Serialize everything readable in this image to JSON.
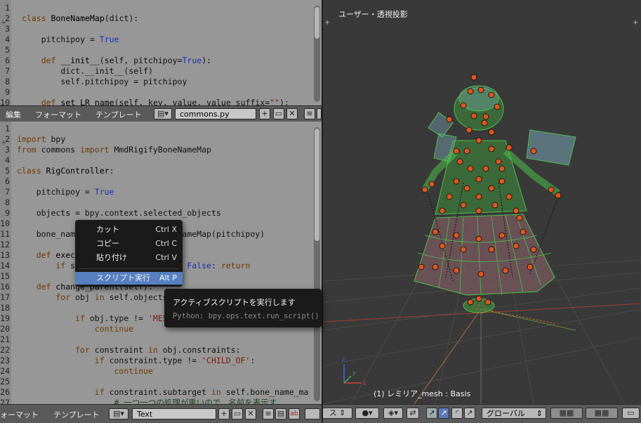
{
  "top_editor": {
    "lines": [
      {
        "n": "1",
        "parts": []
      },
      {
        "n": "2",
        "parts": [
          [
            "kw",
            "class "
          ],
          [
            "fn",
            "BoneNameMap"
          ],
          [
            "plain",
            "(dict):"
          ]
        ]
      },
      {
        "n": "3",
        "parts": []
      },
      {
        "n": "4",
        "parts": [
          [
            "plain",
            "    pitchipoy = "
          ],
          [
            "blue",
            "True"
          ]
        ]
      },
      {
        "n": "5",
        "parts": []
      },
      {
        "n": "6",
        "parts": [
          [
            "plain",
            "    "
          ],
          [
            "kw",
            "def "
          ],
          [
            "fn",
            "__init__"
          ],
          [
            "plain",
            "(self, pitchipoy="
          ],
          [
            "blue",
            "True"
          ],
          [
            "plain",
            "):"
          ]
        ]
      },
      {
        "n": "7",
        "parts": [
          [
            "plain",
            "        dict.__init__(self)"
          ]
        ]
      },
      {
        "n": "8",
        "parts": [
          [
            "plain",
            "        self.pitchipoy = pitchipoy"
          ]
        ]
      },
      {
        "n": "9",
        "parts": []
      },
      {
        "n": "10",
        "parts": [
          [
            "plain",
            "    "
          ],
          [
            "kw",
            "def "
          ],
          [
            "fn",
            "set_LR_name"
          ],
          [
            "plain",
            "(self, key, value, value_suffix="
          ],
          [
            "str",
            "\"\""
          ],
          [
            "plain",
            "):"
          ]
        ]
      }
    ]
  },
  "top_header": {
    "menu_edit": "編集",
    "menu_format": "フォーマット",
    "menu_templates": "テンプレート",
    "file_name": "commons.py"
  },
  "bottom_editor": {
    "lines": [
      {
        "n": "1",
        "parts": []
      },
      {
        "n": "2",
        "parts": [
          [
            "kw",
            "import "
          ],
          [
            "plain",
            "bpy"
          ]
        ]
      },
      {
        "n": "3",
        "parts": [
          [
            "kw",
            "from "
          ],
          [
            "plain",
            "commons "
          ],
          [
            "kw",
            "import "
          ],
          [
            "plain",
            "MmdRigifyBoneNameMap"
          ]
        ]
      },
      {
        "n": "4",
        "parts": []
      },
      {
        "n": "5",
        "parts": [
          [
            "kw",
            "class "
          ],
          [
            "fn",
            "RigController"
          ],
          [
            "plain",
            ":"
          ]
        ]
      },
      {
        "n": "6",
        "parts": []
      },
      {
        "n": "7",
        "parts": [
          [
            "plain",
            "    pitchipoy = "
          ],
          [
            "blue",
            "True"
          ]
        ]
      },
      {
        "n": "8",
        "parts": []
      },
      {
        "n": "9",
        "parts": [
          [
            "plain",
            "    objects = bpy.context.selected_objects"
          ]
        ]
      },
      {
        "n": "10",
        "parts": []
      },
      {
        "n": "11",
        "parts": [
          [
            "plain",
            "    bone_name_m"
          ],
          [
            "plain",
            "ap = MmdRigifyBoneNameMap(pitchipoy)"
          ]
        ]
      },
      {
        "n": "12",
        "parts": []
      },
      {
        "n": "13",
        "parts": [
          [
            "plain",
            "    "
          ],
          [
            "kw",
            "def "
          ],
          [
            "fn",
            "execute"
          ]
        ]
      },
      {
        "n": "14",
        "parts": [
          [
            "plain",
            "        "
          ],
          [
            "kw",
            "if "
          ],
          [
            "plain",
            "self.change_parent() == "
          ],
          [
            "blue",
            "False"
          ],
          [
            "plain",
            ": "
          ],
          [
            "kw",
            "return"
          ]
        ]
      },
      {
        "n": "15",
        "parts": []
      },
      {
        "n": "16",
        "parts": [
          [
            "plain",
            "    "
          ],
          [
            "kw",
            "def "
          ],
          [
            "fn",
            "change_parent"
          ],
          [
            "plain",
            "(self):"
          ]
        ]
      },
      {
        "n": "17",
        "parts": [
          [
            "plain",
            "        "
          ],
          [
            "kw",
            "for "
          ],
          [
            "plain",
            "obj "
          ],
          [
            "kw",
            "in "
          ],
          [
            "plain",
            "self.objects:"
          ]
        ]
      },
      {
        "n": "18",
        "parts": []
      },
      {
        "n": "19",
        "parts": [
          [
            "plain",
            "            "
          ],
          [
            "kw",
            "if "
          ],
          [
            "plain",
            "obj.type != "
          ],
          [
            "str",
            "'MESH'"
          ],
          [
            "plain",
            ":"
          ]
        ]
      },
      {
        "n": "20",
        "parts": [
          [
            "plain",
            "                "
          ],
          [
            "kw",
            "continue"
          ]
        ]
      },
      {
        "n": "21",
        "parts": []
      },
      {
        "n": "22",
        "parts": [
          [
            "plain",
            "            "
          ],
          [
            "kw",
            "for "
          ],
          [
            "plain",
            "constraint "
          ],
          [
            "kw",
            "in "
          ],
          [
            "plain",
            "obj.constraints:"
          ]
        ]
      },
      {
        "n": "23",
        "parts": [
          [
            "plain",
            "                "
          ],
          [
            "kw",
            "if "
          ],
          [
            "plain",
            "constraint.type != "
          ],
          [
            "str",
            "'CHILD_OF'"
          ],
          [
            "plain",
            ":"
          ]
        ]
      },
      {
        "n": "24",
        "parts": [
          [
            "plain",
            "                    "
          ],
          [
            "kw",
            "continue"
          ]
        ]
      },
      {
        "n": "25",
        "parts": []
      },
      {
        "n": "26",
        "parts": [
          [
            "plain",
            "                "
          ],
          [
            "kw",
            "if "
          ],
          [
            "plain",
            "constraint.subtarget "
          ],
          [
            "kw",
            "in "
          ],
          [
            "plain",
            "self.bone_name_ma"
          ]
        ]
      },
      {
        "n": "27",
        "parts": [
          [
            "cm",
            "                    # 一つ一つの処理が重いので、名前を表示す"
          ]
        ]
      }
    ]
  },
  "bottom_header": {
    "menu_format": "ォーマット",
    "menu_templates": "テンプレート",
    "text_name": "Text"
  },
  "context_menu": {
    "items": [
      {
        "label": "カット",
        "shortcut": "Ctrl X"
      },
      {
        "label": "コピー",
        "shortcut": "Ctrl C"
      },
      {
        "label": "貼り付け",
        "shortcut": "Ctrl V"
      },
      {
        "label": "スクリプト実行",
        "shortcut": "Alt P"
      }
    ]
  },
  "tooltip": {
    "title": "アクティブスクリプトを実行します",
    "python": "Python: bpy.ops.text.run_script()"
  },
  "viewport": {
    "title": "ユーザー・透視投影",
    "object_info": "(1) レミリア_mesh : Basis",
    "header": {
      "mode_partial": "ス",
      "orientation": "グローバル"
    }
  },
  "colors": {
    "editor_bg": "#979797",
    "header_bg": "#5a5a5a",
    "viewport_bg": "#393939",
    "menu_bg": "#1a1a1a",
    "menu_active": "#5680c2",
    "bone_orange": "#e2561c",
    "mesh_green": "#4ec04a"
  }
}
